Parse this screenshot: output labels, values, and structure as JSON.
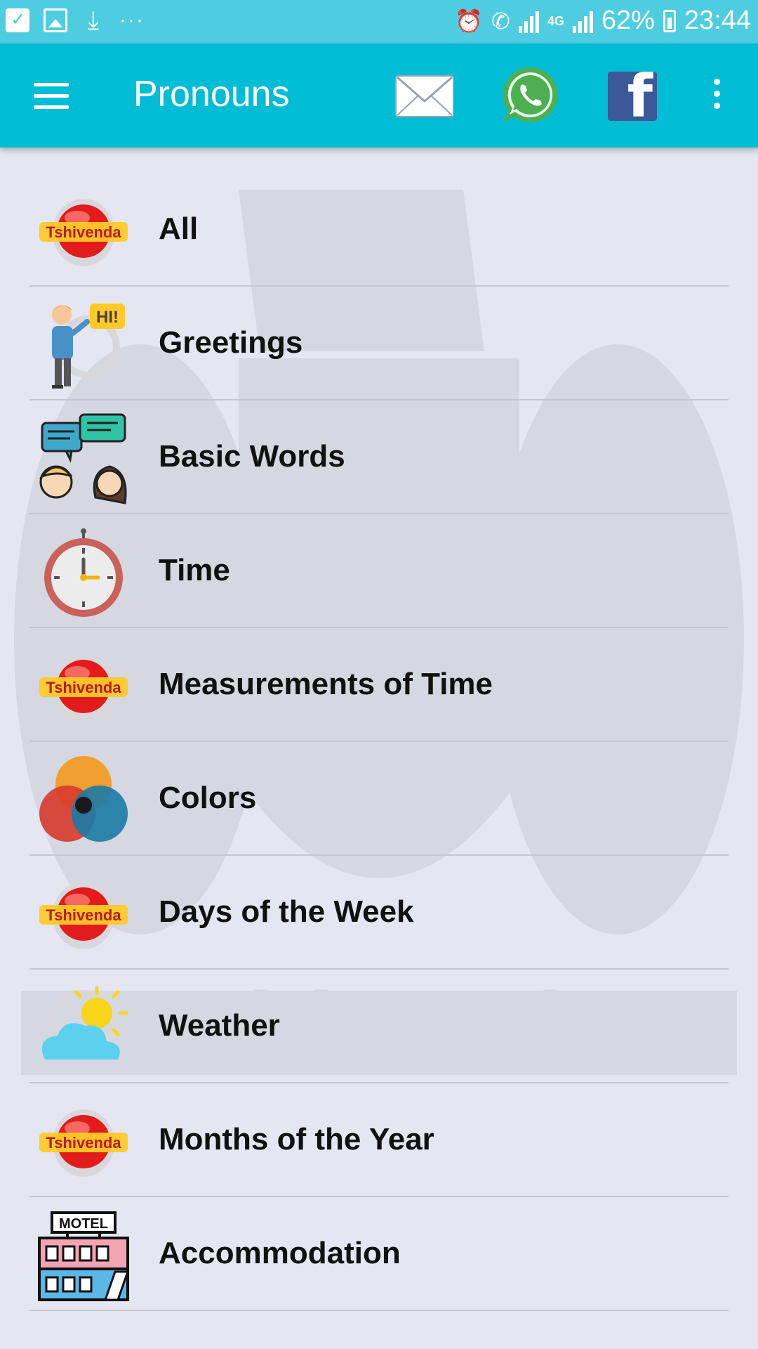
{
  "status_bar": {
    "battery": "62%",
    "time": "23:44",
    "network": "4G",
    "icons": [
      "notification-check-icon",
      "gallery-icon",
      "download-icon",
      "more-dots-icon",
      "alarm-icon",
      "call-icon",
      "signal-icon",
      "network-4g-icon",
      "signal-icon",
      "battery-icon"
    ]
  },
  "toolbar": {
    "title": "Pronouns",
    "icons": [
      "menu-icon",
      "mail-icon",
      "whatsapp-icon",
      "facebook-icon",
      "overflow-menu-icon"
    ],
    "colors": {
      "bar": "#00bcd4",
      "status": "#4fcde0",
      "whatsapp": "#4caf50",
      "facebook": "#3b5998"
    }
  },
  "brand_text": "Tshivenda",
  "categories": [
    {
      "label": "All",
      "icon": "tshivenda-logo-icon"
    },
    {
      "label": "Greetings",
      "icon": "greeting-person-icon",
      "bubble": "HI!"
    },
    {
      "label": "Basic Words",
      "icon": "chat-people-icon"
    },
    {
      "label": "Time",
      "icon": "clock-icon"
    },
    {
      "label": "Measurements of Time",
      "icon": "tshivenda-logo-icon"
    },
    {
      "label": "Colors",
      "icon": "color-circles-icon"
    },
    {
      "label": "Days of the Week",
      "icon": "tshivenda-logo-icon"
    },
    {
      "label": "Weather",
      "icon": "sun-cloud-icon"
    },
    {
      "label": "Months of the Year",
      "icon": "tshivenda-logo-icon"
    },
    {
      "label": "Accommodation",
      "icon": "motel-icon",
      "sign": "MOTEL"
    }
  ]
}
